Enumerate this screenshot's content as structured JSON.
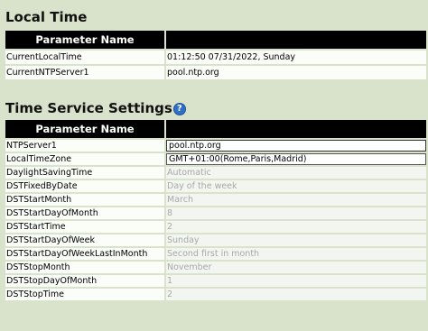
{
  "local_time": {
    "title": "Local Time",
    "header": "Parameter Name",
    "rows": [
      {
        "name": "CurrentLocalTime",
        "value": "01:12:50 07/31/2022, Sunday"
      },
      {
        "name": "CurrentNTPServer1",
        "value": "pool.ntp.org"
      }
    ]
  },
  "time_service": {
    "title": "Time Service Settings",
    "help_icon": "question-icon",
    "header": "Parameter Name",
    "rows": [
      {
        "name": "NTPServer1",
        "value": "pool.ntp.org",
        "kind": "input"
      },
      {
        "name": "LocalTimeZone",
        "value": "GMT+01:00(Rome,Paris,Madrid)",
        "kind": "select"
      },
      {
        "name": "DaylightSavingTime",
        "value": "Automatic",
        "kind": "disabled"
      },
      {
        "name": "DSTFixedByDate",
        "value": "Day of the week",
        "kind": "disabled"
      },
      {
        "name": "DSTStartMonth",
        "value": "March",
        "kind": "disabled"
      },
      {
        "name": "DSTStartDayOfMonth",
        "value": "8",
        "kind": "disabled"
      },
      {
        "name": "DSTStartTime",
        "value": "2",
        "kind": "disabled"
      },
      {
        "name": "DSTStartDayOfWeek",
        "value": "Sunday",
        "kind": "disabled"
      },
      {
        "name": "DSTStartDayOfWeekLastInMonth",
        "value": "Second first in month",
        "kind": "disabled"
      },
      {
        "name": "DSTStopMonth",
        "value": "November",
        "kind": "disabled"
      },
      {
        "name": "DSTStopDayOfMonth",
        "value": "1",
        "kind": "disabled"
      },
      {
        "name": "DSTStopTime",
        "value": "2",
        "kind": "disabled"
      }
    ]
  }
}
